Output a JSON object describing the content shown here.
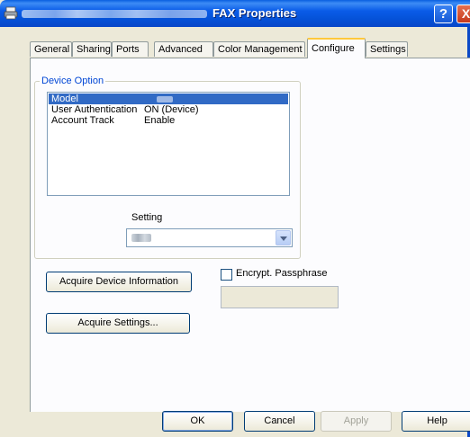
{
  "window": {
    "title": "FAX Properties",
    "help_label": "?",
    "close_label": "X"
  },
  "tabs": [
    {
      "label": "General"
    },
    {
      "label": "Sharing"
    },
    {
      "label": "Ports"
    },
    {
      "label": "Advanced"
    },
    {
      "label": "Color Management"
    },
    {
      "label": "Configure",
      "active": true
    },
    {
      "label": "Settings"
    }
  ],
  "device_option": {
    "legend": "Device Option",
    "rows": [
      {
        "name": "Model",
        "value": "",
        "selected": true
      },
      {
        "name": "User Authentication",
        "value": "ON (Device)"
      },
      {
        "name": "Account Track",
        "value": "Enable"
      }
    ],
    "setting_label": "Setting"
  },
  "buttons": {
    "acquire_device_info": "Acquire Device Information",
    "acquire_settings": "Acquire Settings...",
    "ok": "OK",
    "cancel": "Cancel",
    "apply": "Apply",
    "help": "Help"
  },
  "encrypt": {
    "label": "Encrypt. Passphrase",
    "checked": false
  },
  "colors": {
    "titlebar": "#0a5ce8",
    "selection": "#316ac5",
    "tab_highlight": "#ffc83c",
    "legend": "#0046d5"
  }
}
